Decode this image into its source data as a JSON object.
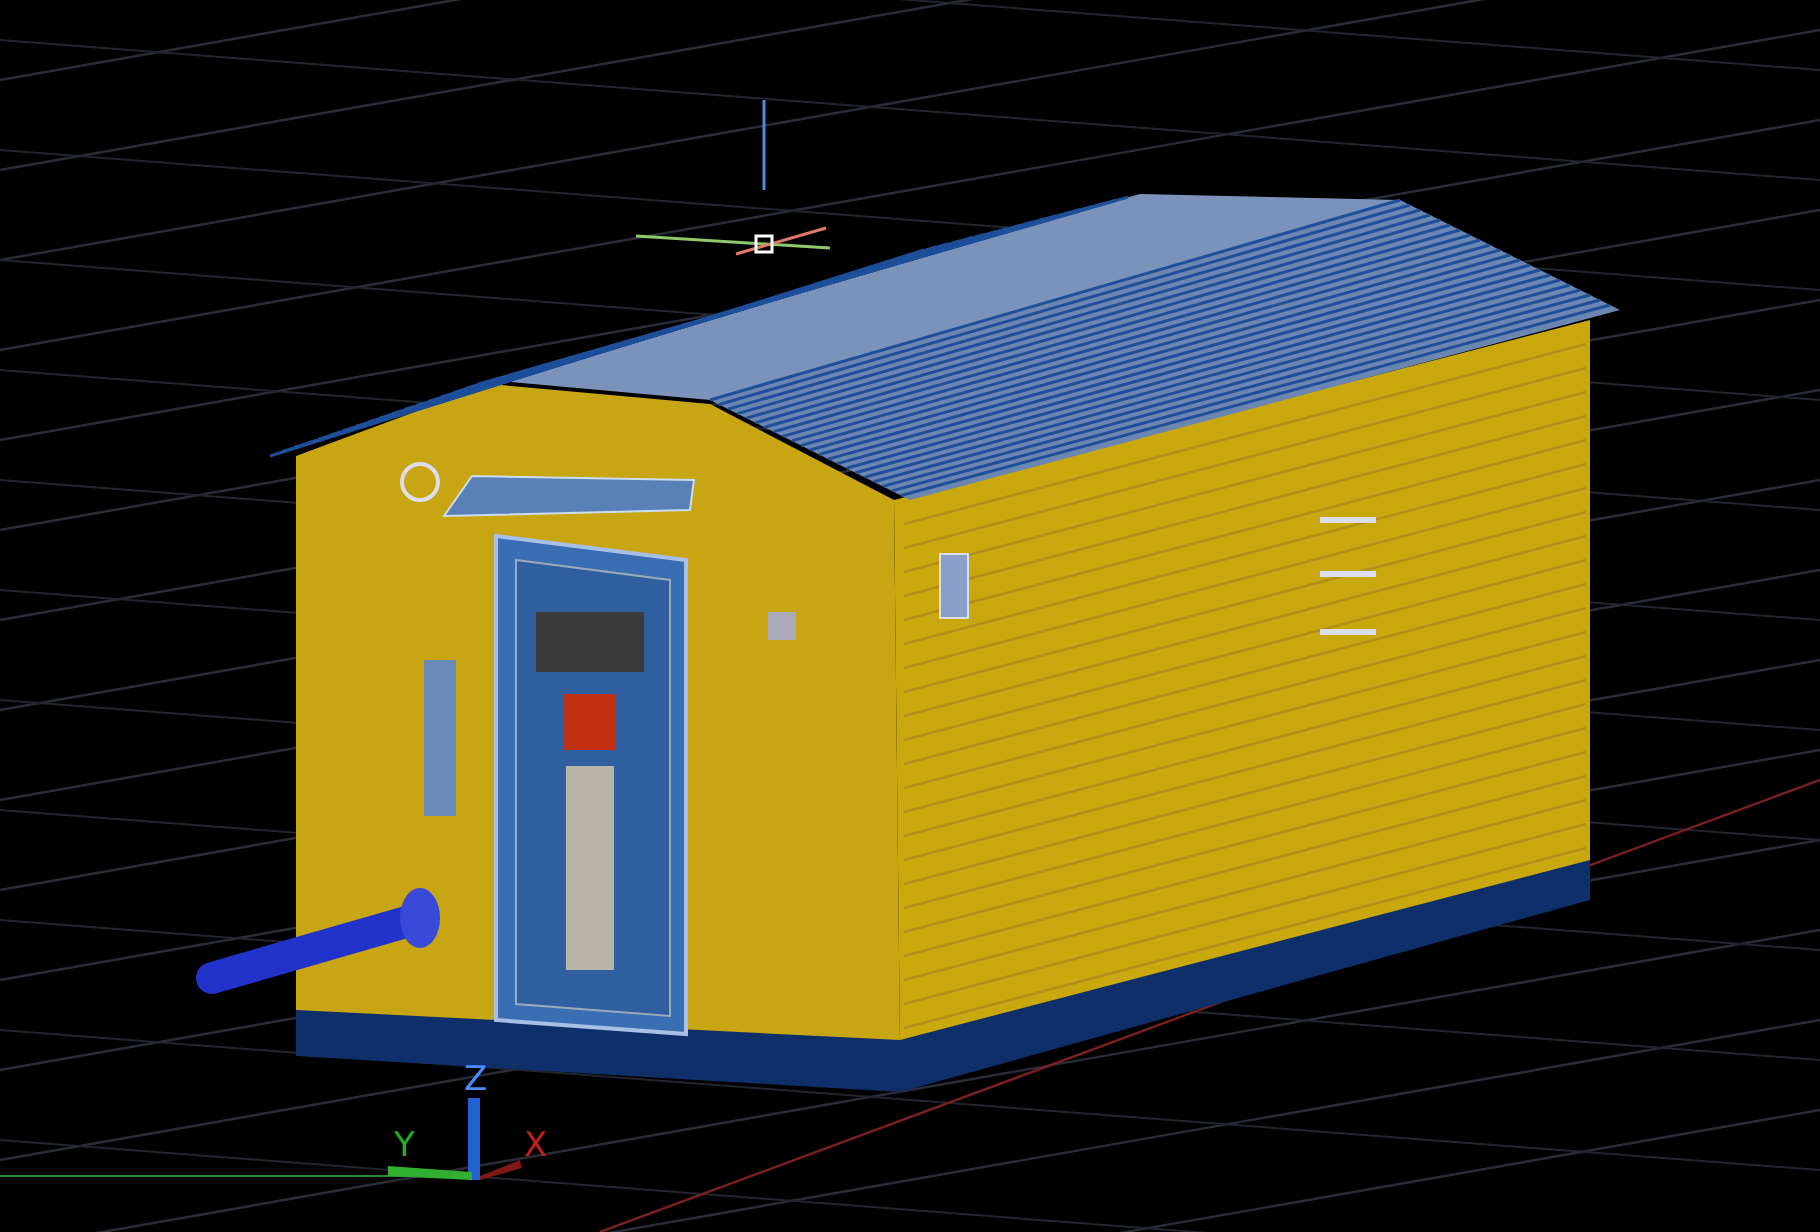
{
  "viewport": {
    "ucs_axes": [
      {
        "label": "Z",
        "color": "#4a8cff"
      },
      {
        "label": "Y",
        "color": "#22b022"
      },
      {
        "label": "X",
        "color": "#c02020"
      }
    ]
  }
}
